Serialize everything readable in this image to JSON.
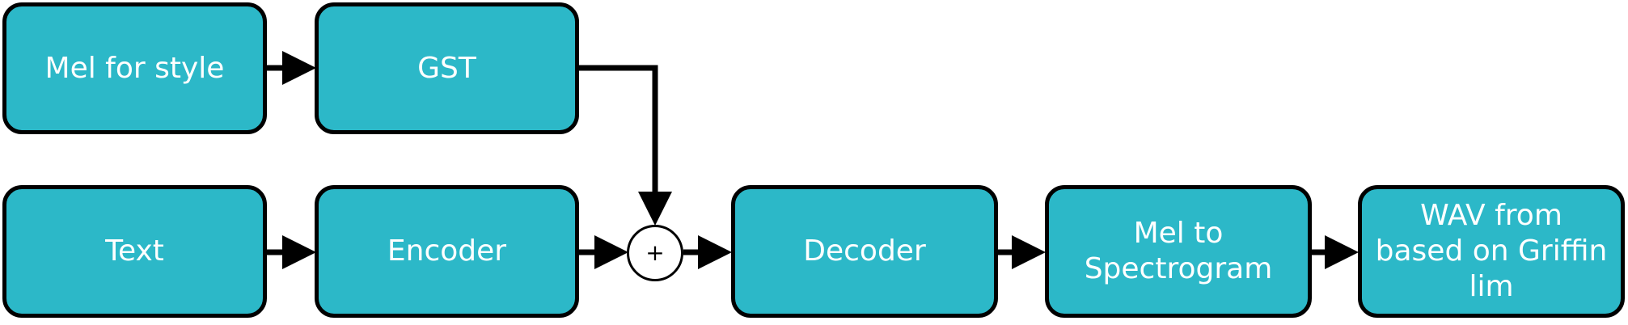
{
  "nodes": {
    "mel_for_style": "Mel for style",
    "gst": "GST",
    "text": "Text",
    "encoder": "Encoder",
    "decoder": "Decoder",
    "mel_to_spectrogram": [
      "Mel to",
      "Spectrogram"
    ],
    "wav": [
      "WAV from",
      "based on Griffin",
      "lim"
    ],
    "sum_symbol": "+"
  },
  "colors": {
    "box_fill": "#2cb8c8",
    "box_border": "#000000",
    "box_text": "#ffffff",
    "arrow": "#000000"
  }
}
